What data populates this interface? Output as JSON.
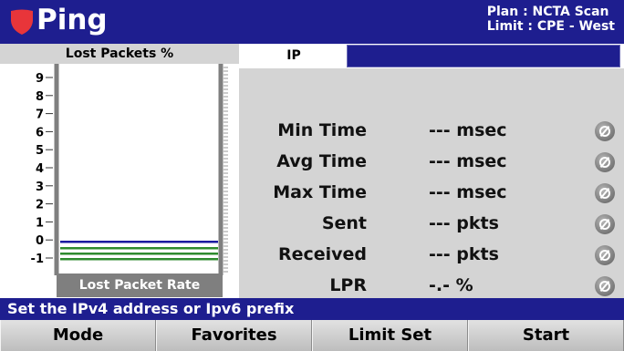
{
  "header": {
    "title": "Ping",
    "plan": "Plan : NCTA Scan",
    "limit": "Limit : CPE - West"
  },
  "chart": {
    "title": "Lost Packets %",
    "footer_label": "Lost Packet Rate",
    "y_ticks": [
      "9",
      "8",
      "7",
      "6",
      "5",
      "4",
      "3",
      "2",
      "1",
      "0",
      "-1"
    ]
  },
  "chart_data": {
    "type": "bar",
    "title": "Lost Packets %",
    "xlabel": "Lost Packet Rate",
    "ylabel": "",
    "ylim": [
      -1,
      9
    ],
    "categories": [],
    "values": []
  },
  "ip": {
    "label": "IP",
    "value": ""
  },
  "stats": [
    {
      "label": "Min Time",
      "value": "--- msec"
    },
    {
      "label": "Avg Time",
      "value": "--- msec"
    },
    {
      "label": "Max Time",
      "value": "--- msec"
    },
    {
      "label": "Sent",
      "value": "--- pkts"
    },
    {
      "label": "Received",
      "value": "--- pkts"
    },
    {
      "label": "LPR",
      "value": "-.- %"
    }
  ],
  "status_message": "Set the IPv4 address or Ipv6 prefix",
  "softkeys": [
    "Mode",
    "Favorites",
    "Limit Set",
    "Start"
  ],
  "colors": {
    "brand": "#1e1e8f",
    "shield": "#e8353a",
    "line_blue": "#1a1aa0",
    "line_green": "#2e8b2e"
  }
}
